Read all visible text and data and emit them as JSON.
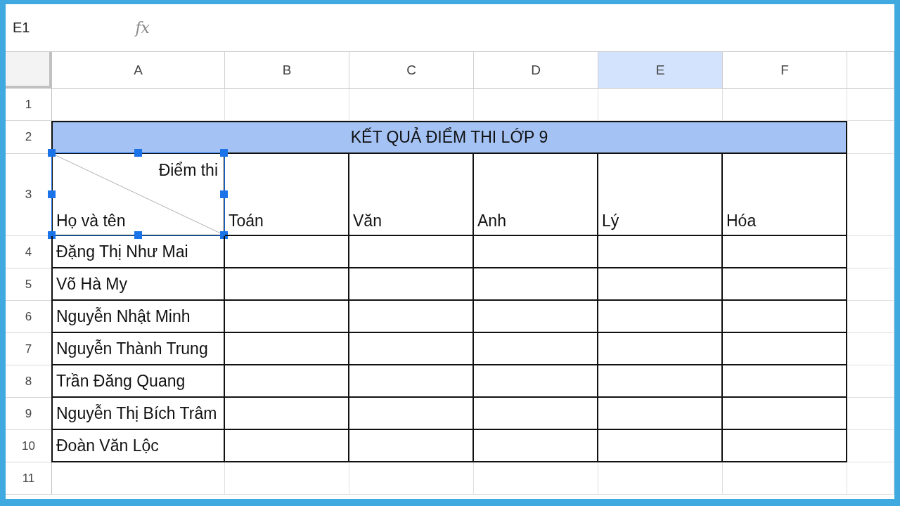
{
  "name_box": "E1",
  "formula_icon": "fx",
  "columns": [
    {
      "label": "A",
      "selected": false
    },
    {
      "label": "B",
      "selected": false
    },
    {
      "label": "C",
      "selected": false
    },
    {
      "label": "D",
      "selected": false
    },
    {
      "label": "E",
      "selected": true
    },
    {
      "label": "F",
      "selected": false
    }
  ],
  "row_headers": [
    "1",
    "2",
    "3",
    "4",
    "5",
    "6",
    "7",
    "8",
    "9",
    "10",
    "11"
  ],
  "table": {
    "title": "KẾT QUẢ ĐIỂM THI LỚP 9",
    "corner_top": "Điểm thi",
    "corner_bottom": "Họ và tên",
    "subjects": [
      "Toán",
      "Văn",
      "Anh",
      "Lý",
      "Hóa"
    ],
    "students": [
      "Đặng Thị Như Mai",
      "Võ Hà My",
      "Nguyễn Nhật Minh",
      "Nguyễn Thành Trung",
      "Trần Đăng Quang",
      "Nguyễn Thị Bích Trâm",
      "Đoàn Văn Lộc"
    ]
  }
}
